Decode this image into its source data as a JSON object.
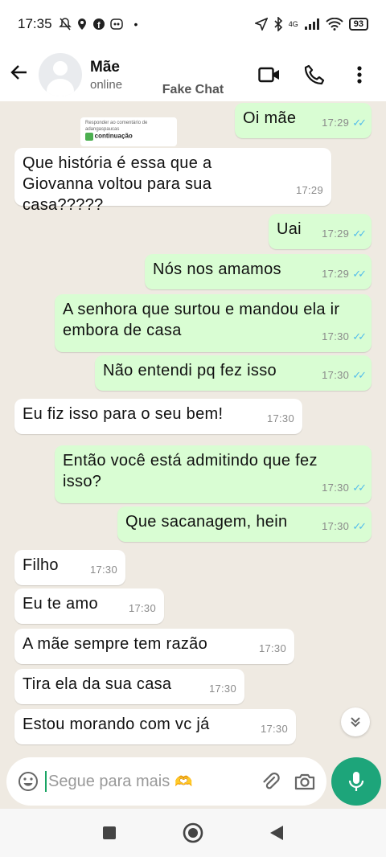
{
  "status_bar": {
    "time": "17:35",
    "network": "4G",
    "battery": "93"
  },
  "header": {
    "back_label": "←",
    "name": "Mãe",
    "status": "online"
  },
  "watermark": "Fake Chat",
  "sticker": {
    "line1": "Responder ao comentário de",
    "line2": "adangaspaucas",
    "label": "continuação"
  },
  "messages": [
    {
      "dir": "out",
      "text": "Oi mãe",
      "time": "17:29",
      "read": true
    },
    {
      "dir": "in",
      "text": "Que história é essa que a Giovanna voltou para sua casa?????",
      "time": "17:29"
    },
    {
      "dir": "out",
      "text": "Uai",
      "time": "17:29",
      "read": true
    },
    {
      "dir": "out",
      "text": "Nós nos amamos",
      "time": "17:29",
      "read": true
    },
    {
      "dir": "out",
      "text": "A senhora que surtou e mandou ela ir embora de casa",
      "time": "17:30",
      "read": true
    },
    {
      "dir": "out",
      "text": "Não entendi pq fez isso",
      "time": "17:30",
      "read": true
    },
    {
      "dir": "in",
      "text": "Eu fiz isso para o seu bem!",
      "time": "17:30"
    },
    {
      "dir": "out",
      "text": "Então você está admitindo que fez isso?",
      "time": "17:30",
      "read": true
    },
    {
      "dir": "out",
      "text": "Que sacanagem, hein",
      "time": "17:30",
      "read": true
    },
    {
      "dir": "in",
      "text": "Filho",
      "time": "17:30"
    },
    {
      "dir": "in",
      "text": "Eu te amo",
      "time": "17:30"
    },
    {
      "dir": "in",
      "text": "A mãe sempre tem razão",
      "time": "17:30"
    },
    {
      "dir": "in",
      "text": "Tira ela da sua casa",
      "time": "17:30"
    },
    {
      "dir": "in",
      "text": "Estou morando com vc já",
      "time": "17:30"
    }
  ],
  "input": {
    "text": "Segue para mais",
    "emoji": "🫶"
  },
  "icons": {
    "header": [
      "video-call-icon",
      "phone-call-icon",
      "more-options-icon"
    ],
    "input": [
      "emoji-icon",
      "attach-icon",
      "camera-icon"
    ],
    "nav": [
      "recents-icon",
      "home-icon",
      "back-nav-icon"
    ]
  },
  "colors": {
    "out_bubble": "#d9fdd3",
    "in_bubble": "#ffffff",
    "accent": "#1da57a",
    "ticks": "#53bdeb"
  }
}
